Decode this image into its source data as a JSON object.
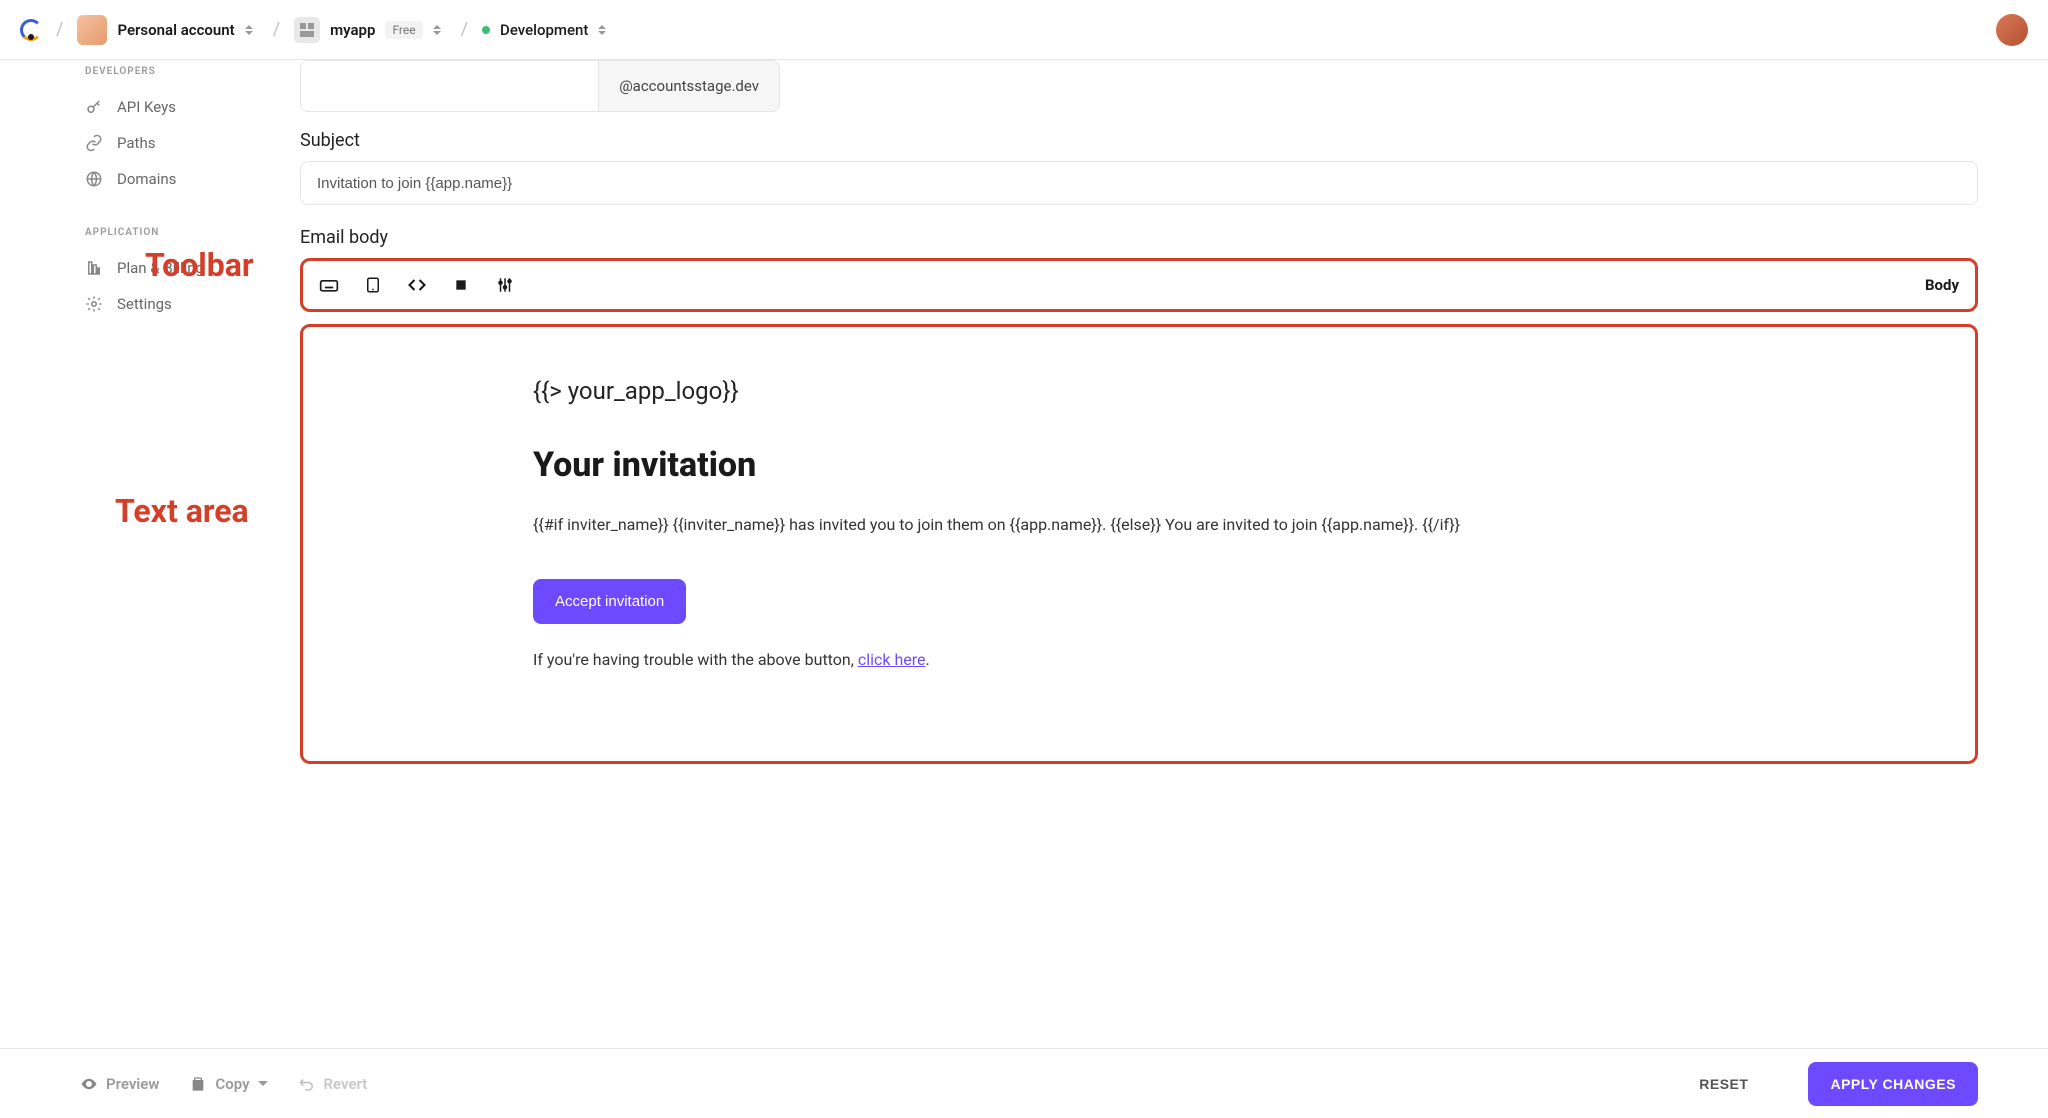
{
  "header": {
    "account_label": "Personal account",
    "app_name": "myapp",
    "plan_badge": "Free",
    "env_label": "Development"
  },
  "sidebar": {
    "groups": [
      {
        "title": "DEVELOPERS",
        "items": [
          {
            "label": "API Keys"
          },
          {
            "label": "Paths"
          },
          {
            "label": "Domains"
          }
        ]
      },
      {
        "title": "APPLICATION",
        "items": [
          {
            "label": "Plan & Billing"
          },
          {
            "label": "Settings"
          }
        ]
      }
    ]
  },
  "form": {
    "email_suffix": "@accountsstage.dev",
    "subject_label": "Subject",
    "subject_value": "Invitation to join {{app.name}}",
    "body_label": "Email body",
    "toolbar_mode": "Body"
  },
  "email_preview": {
    "logo_placeholder": "{{> your_app_logo}}",
    "heading": "Your invitation",
    "paragraph": "{{#if inviter_name}} {{inviter_name}} has invited you to join them on {{app.name}}. {{else}} You are invited to join {{app.name}}. {{/if}}",
    "cta_label": "Accept invitation",
    "trouble_prefix": "If you're having trouble with the above button, ",
    "trouble_link": "click here",
    "trouble_suffix": "."
  },
  "annotations": {
    "toolbar": "Toolbar",
    "textarea": "Text area"
  },
  "footer": {
    "preview": "Preview",
    "copy": "Copy",
    "revert": "Revert",
    "reset": "RESET",
    "apply": "APPLY CHANGES"
  }
}
